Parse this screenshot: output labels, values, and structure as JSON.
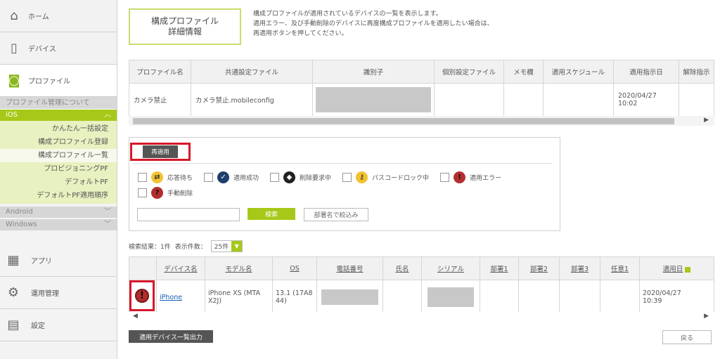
{
  "sidebar": {
    "home": "ホーム",
    "device": "デバイス",
    "profile": "プロファイル",
    "about_profile": "プロファイル管理について",
    "ios_label": "iOS",
    "ios_items": [
      "かんたん一括設定",
      "構成プロファイル登録",
      "構成プロファイル一覧",
      "プロビジョニングPF",
      "デフォルトPF",
      "デフォルトPF適用順序"
    ],
    "android": "Android",
    "windows": "Windows",
    "apps": "アプリ",
    "operations": "運用管理",
    "settings": "設定"
  },
  "header": {
    "title_line1": "構成プロファイル",
    "title_line2": "詳細情報",
    "desc_line1": "構成プロファイルが適用されているデバイスの一覧を表示します。",
    "desc_line2": "適用エラー、及び手動削除のデバイスに再度構成プロファイルを適用したい場合は、",
    "desc_line3": "再適用ボタンを押してください。"
  },
  "profile_table": {
    "headers": [
      "プロファイル名",
      "共通設定ファイル",
      "識別子",
      "個別設定ファイル",
      "メモ欄",
      "適用スケジュール",
      "適用指示日",
      "解除指示"
    ],
    "row": {
      "name": "カメラ禁止",
      "common_file": "カメラ禁止.mobileconfig",
      "instruct_date_line1": "2020/04/27",
      "instruct_date_line2": "10:02"
    }
  },
  "filter": {
    "reapply": "再適用",
    "statuses": [
      "応答待ち",
      "適用成功",
      "削除要求中",
      "パスコードロック中",
      "適用エラー",
      "手動削除"
    ],
    "search": "検索",
    "dept_filter": "部署名で絞込み"
  },
  "results": {
    "count_label": "検索結果：1件",
    "display_label": "表示件数：",
    "display_value": "25件"
  },
  "device_table": {
    "headers": [
      "デバイス名",
      "モデル名",
      "OS",
      "電話番号",
      "氏名",
      "シリアル",
      "部署1",
      "部署2",
      "部署3",
      "任意1",
      "適用日"
    ],
    "row": {
      "device": "iPhone",
      "model_line1": "iPhone XS (MTA",
      "model_line2": "X2J)",
      "os_line1": "13.1 (17A8",
      "os_line2": "44)",
      "date_line1": "2020/04/27",
      "date_line2": "10:39"
    }
  },
  "footer": {
    "export": "適用デバイス一覧出力",
    "back": "戻る"
  },
  "colors": {
    "accent": "#a6c919",
    "highlight": "#d7182a"
  }
}
